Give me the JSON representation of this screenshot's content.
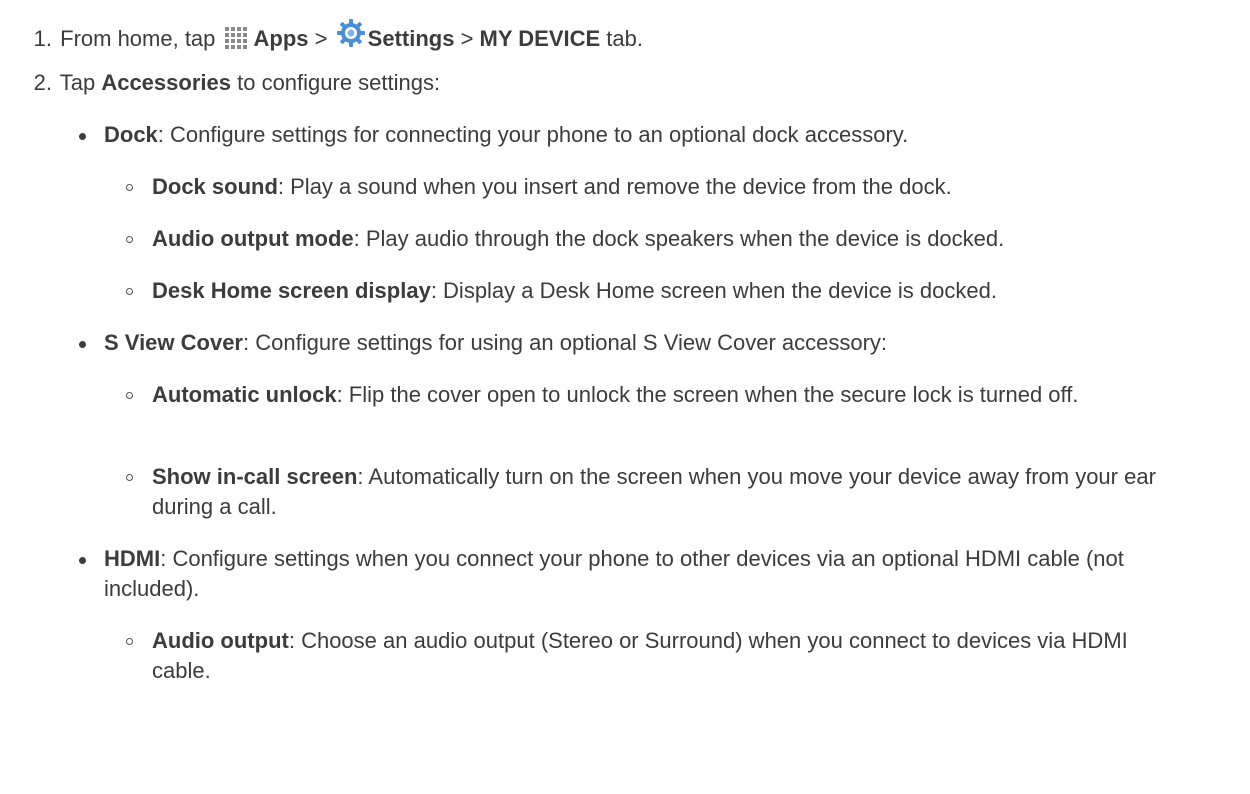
{
  "step1": {
    "number": "1.",
    "from_home": "From home, tap",
    "apps": "Apps",
    "sep1": ">",
    "settings": "Settings",
    "sep2": ">",
    "my_device": "MY DEVICE",
    "tab": "tab."
  },
  "step2": {
    "number": "2.",
    "tap": "Tap",
    "accessories": "Accessories",
    "rest": "to configure settings:"
  },
  "items": {
    "dock": {
      "term": "Dock",
      "desc": ": Configure settings for connecting your phone to an optional dock accessory."
    },
    "dock_sound": {
      "term": "Dock sound",
      "desc": ": Play a sound when you insert and remove the device from the dock."
    },
    "audio_output_mode": {
      "term": "Audio output mode",
      "desc": ": Play audio through the dock speakers when the device is docked."
    },
    "desk_home": {
      "term": "Desk Home screen display",
      "desc": ": Display a Desk Home screen when the device is docked."
    },
    "s_view_cover": {
      "term": "S View Cover",
      "desc": ": Configure settings for using an optional S View Cover accessory:"
    },
    "automatic_unlock": {
      "term": "Automatic unlock",
      "desc": ": Flip the cover open to unlock the screen when the secure lock is turned off."
    },
    "show_in_call": {
      "term": "Show in-call screen",
      "desc": ": Automatically turn on the screen when you move your device away from your ear during a call."
    },
    "hdmi": {
      "term": "HDMI",
      "desc": ": Configure settings when you connect your phone to other devices via an optional HDMI cable (not included)."
    },
    "audio_output": {
      "term": "Audio output",
      "desc": ": Choose an audio output (Stereo or Surround) when you connect to devices via HDMI cable."
    }
  },
  "icons": {
    "apps": "apps-grid-icon",
    "settings": "settings-gear-icon"
  },
  "colors": {
    "text": "#3c3c3c",
    "settings_icon_blue": "#4a8fd6"
  }
}
